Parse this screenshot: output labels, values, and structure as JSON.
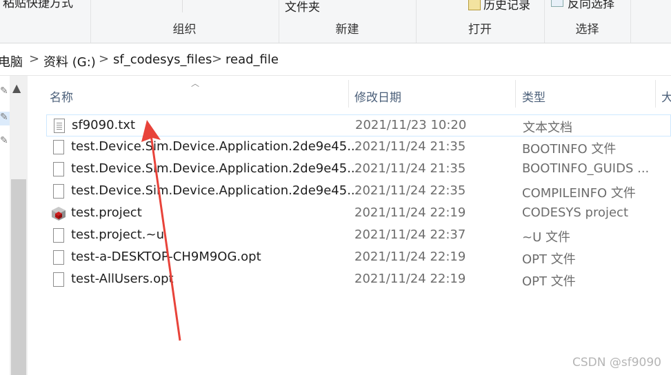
{
  "ribbon": {
    "groups": [
      {
        "label": "组织",
        "top_text": "粘贴快捷方式"
      },
      {
        "label": "新建",
        "top_text": "文件夹"
      },
      {
        "label": "打开",
        "top_text": "历史记录"
      },
      {
        "label": "选择",
        "top_text": "反向选择"
      }
    ]
  },
  "address": {
    "crumbs": [
      "电脑",
      "资料 (G:)",
      "sf_codesys_files",
      "read_file"
    ],
    "separator": ">"
  },
  "columns": {
    "name": "名称",
    "date": "修改日期",
    "type": "类型",
    "size": "大"
  },
  "files": [
    {
      "name": "sf9090.txt",
      "date": "2021/11/23 10:20",
      "type": "文本文档",
      "icon": "text-file-icon"
    },
    {
      "name": "test.Device.Sim.Device.Application.2de9e45...",
      "date": "2021/11/24 21:35",
      "type": "BOOTINFO 文件",
      "icon": "file-icon"
    },
    {
      "name": "test.Device.Sim.Device.Application.2de9e45...",
      "date": "2021/11/24 21:35",
      "type": "BOOTINFO_GUIDS ...",
      "icon": "file-icon"
    },
    {
      "name": "test.Device.Sim.Device.Application.2de9e45...",
      "date": "2021/11/24 22:35",
      "type": "COMPILEINFO 文件",
      "icon": "file-icon"
    },
    {
      "name": "test.project",
      "date": "2021/11/24 22:19",
      "type": "CODESYS project",
      "icon": "codesys-project-icon"
    },
    {
      "name": "test.project.~u",
      "date": "2021/11/24 22:37",
      "type": "~U 文件",
      "icon": "file-icon"
    },
    {
      "name": "test-a-DESKTOP-CH9M9OG.opt",
      "date": "2021/11/24 22:19",
      "type": "OPT 文件",
      "icon": "file-icon"
    },
    {
      "name": "test-AllUsers.opt",
      "date": "2021/11/24 22:19",
      "type": "OPT 文件",
      "icon": "file-icon"
    }
  ],
  "watermark": "CSDN @sf9090",
  "colors": {
    "annotation_arrow": "#e8433a",
    "column_header": "#4c607a",
    "selection_border": "#cde8ff"
  }
}
